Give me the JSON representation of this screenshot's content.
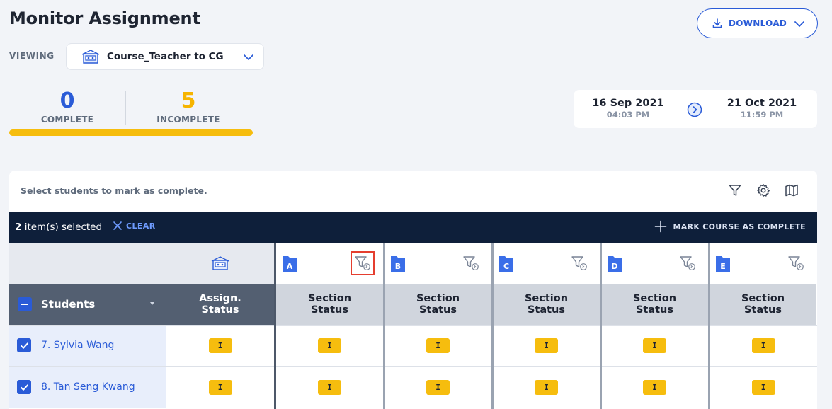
{
  "page": {
    "title": "Monitor Assignment"
  },
  "download": {
    "label": "DOWNLOAD"
  },
  "viewing": {
    "label": "VIEWING",
    "selected": "Course_Teacher to CG"
  },
  "stats": {
    "complete": {
      "value": "0",
      "label": "COMPLETE"
    },
    "incomplete": {
      "value": "5",
      "label": "INCOMPLETE"
    },
    "progress_fraction_incomplete": 1.0,
    "colors": {
      "complete": "#2a5bd7",
      "incomplete": "#f6b400"
    }
  },
  "dates": {
    "start": {
      "date": "16 Sep 2021",
      "time": "04:03 PM"
    },
    "end": {
      "date": "21 Oct 2021",
      "time": "11:59 PM"
    }
  },
  "panel": {
    "hint": "Select students to mark as complete."
  },
  "selection": {
    "count": "2",
    "count_suffix": " item(s) selected",
    "clear_label": "CLEAR",
    "mark_label": "MARK COURSE AS COMPLETE"
  },
  "table": {
    "students_header": "Students",
    "assign_header_line1": "Assign.",
    "assign_header_line2": "Status",
    "sections": [
      {
        "letter": "A",
        "header1": "Section",
        "header2": "Status"
      },
      {
        "letter": "B",
        "header1": "Section",
        "header2": "Status"
      },
      {
        "letter": "C",
        "header1": "Section",
        "header2": "Status"
      },
      {
        "letter": "D",
        "header1": "Section",
        "header2": "Status"
      },
      {
        "letter": "E",
        "header1": "Section",
        "header2": "Status"
      }
    ],
    "rows": [
      {
        "name": "7. Sylvia Wang",
        "checked": true,
        "assign": "I",
        "sections": [
          "I",
          "I",
          "I",
          "I",
          "I"
        ]
      },
      {
        "name": "8. Tan Seng Kwang",
        "checked": true,
        "assign": "I",
        "sections": [
          "I",
          "I",
          "I",
          "I",
          "I"
        ]
      }
    ]
  },
  "icons": {
    "download": "download-icon",
    "chevron": "chevron-down-icon",
    "course": "classroom-icon",
    "arrow": "arrow-right-circle-icon",
    "filter": "filter-icon",
    "settings": "gear-icon",
    "map": "map-icon",
    "clear": "close-icon",
    "add": "plus-icon",
    "folder": "folder-icon"
  }
}
